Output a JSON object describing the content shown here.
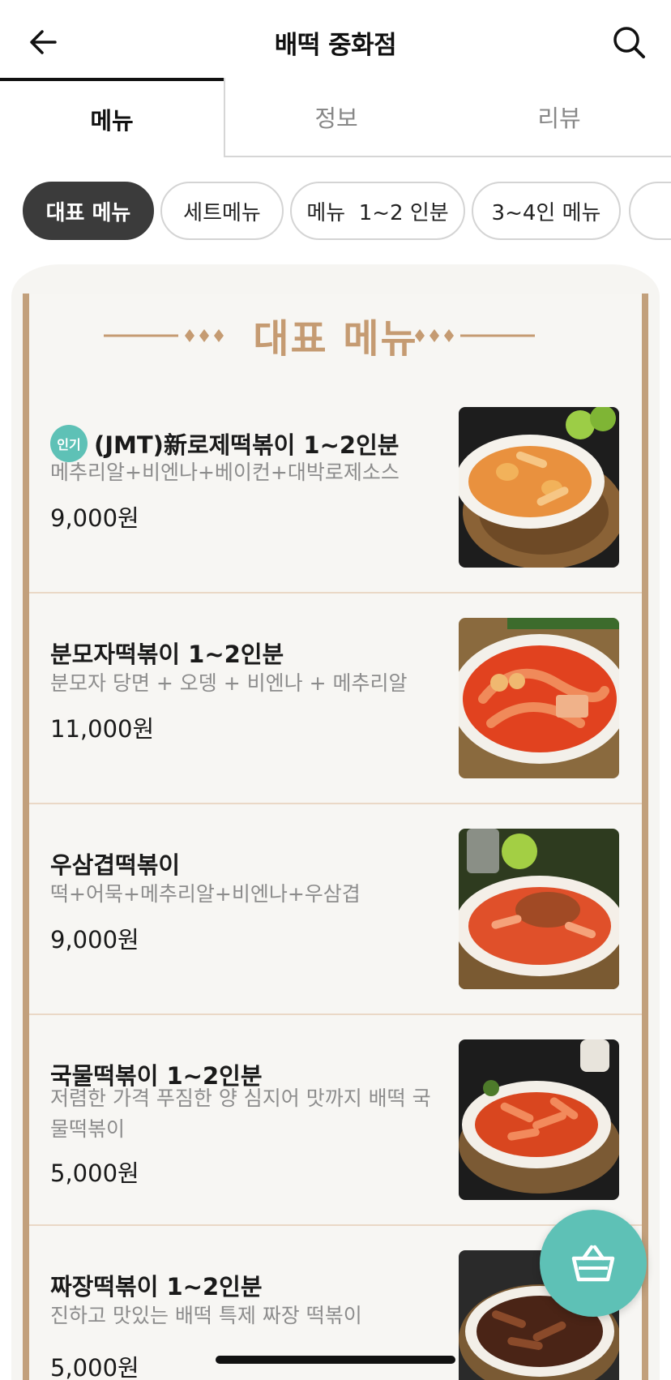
{
  "header": {
    "title": "배떡 중화점"
  },
  "tabs": [
    {
      "label": "메뉴",
      "active": true
    },
    {
      "label": "정보",
      "active": false
    },
    {
      "label": "리뷰",
      "active": false
    }
  ],
  "chips": [
    {
      "label": "대표 메뉴",
      "active": true
    },
    {
      "label": "세트메뉴",
      "active": false
    },
    {
      "label": "메뉴  1~2 인분",
      "active": false
    },
    {
      "label": "3~4인 메뉴",
      "active": false
    }
  ],
  "section": {
    "title": "대표 메뉴"
  },
  "menu_items": [
    {
      "badge": "인기",
      "name": "(JMT)新로제떡볶이 1~2인분",
      "description": "메추리알+비엔나+베이컨+대박로제소스",
      "price": "9,000원",
      "photo": "rose-tteokbokki-photo"
    },
    {
      "name": "분모자떡볶이 1~2인분",
      "description": "분모자 당면 + 오뎅 + 비엔나 + 메추리알",
      "price": "11,000원",
      "photo": "bunmoja-tteokbokki-photo"
    },
    {
      "name": "우삼겹떡볶이",
      "description": "떡+어묵+메추리알+비엔나+우삼겹",
      "price": "9,000원",
      "photo": "beef-brisket-tteokbokki-photo"
    },
    {
      "name": "국물떡볶이 1~2인분",
      "description": "저렴한 가격 푸짐한 양 심지어 맛까지 배떡 국물떡볶이",
      "price": "5,000원",
      "photo": "soup-tteokbokki-photo"
    },
    {
      "name": "짜장떡볶이 1~2인분",
      "description": "진하고 맛있는 배떡 특제 짜장 떡볶이",
      "price": "5,000원",
      "photo": "jjajang-tteokbokki-photo"
    }
  ],
  "colors": {
    "accent": "#5ec1b6",
    "section_gold": "#c59b72",
    "frame": "#c2a07c",
    "chip_active": "#3b3b3b"
  },
  "icons": {
    "back": "arrow-left-icon",
    "search": "search-icon",
    "cart": "basket-icon"
  }
}
